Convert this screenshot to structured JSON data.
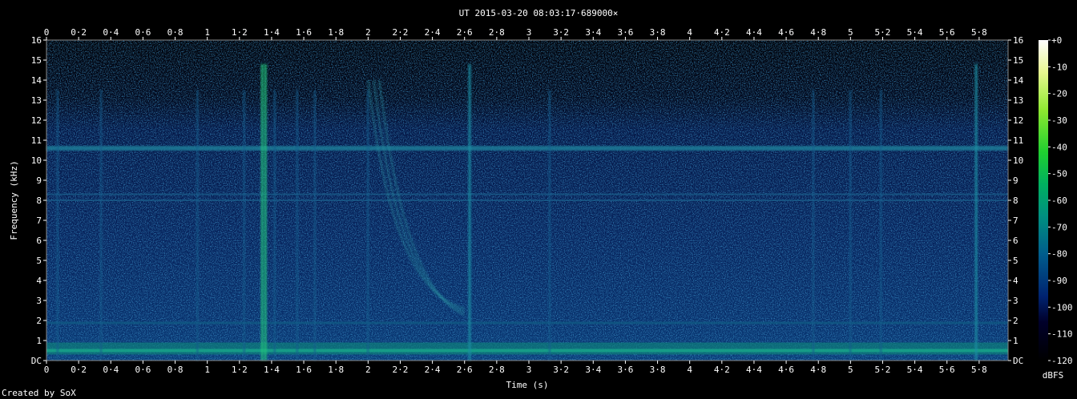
{
  "chart_data": {
    "type": "heatmap",
    "title": "UT 2015-03-20 08:03:17·689000×",
    "xlabel": "Time (s)",
    "ylabel": "Frequency (kHz)",
    "xlim": [
      0,
      5.98
    ],
    "ylim": [
      0,
      16
    ],
    "x_ticks": [
      "0",
      "0·2",
      "0·4",
      "0·6",
      "0·8",
      "1",
      "1·2",
      "1·4",
      "1·6",
      "1·8",
      "2",
      "2·2",
      "2·4",
      "2·6",
      "2·8",
      "3",
      "3·2",
      "3·4",
      "3·6",
      "3·8",
      "4",
      "4·2",
      "4·4",
      "4·6",
      "4·8",
      "5",
      "5·2",
      "5·4",
      "5·6",
      "5·8"
    ],
    "y_ticks": [
      "DC",
      "1",
      "2",
      "3",
      "4",
      "5",
      "6",
      "7",
      "8",
      "9",
      "10",
      "11",
      "12",
      "13",
      "14",
      "15",
      "16"
    ],
    "colorbar": {
      "label": "dBFS",
      "range": [
        -120,
        0
      ],
      "ticks": [
        "+0",
        "-10",
        "-20",
        "-30",
        "-40",
        "-50",
        "-60",
        "-70",
        "-80",
        "-90",
        "-100",
        "-110",
        "-120"
      ]
    },
    "features": {
      "background_level_dbfs": -100,
      "hum_band_khz": 10.6,
      "secondary_bands_khz": [
        8.3,
        8.0
      ],
      "low_band_khz": [
        0.3,
        0.9
      ],
      "vertical_events_s": [
        0.07,
        0.34,
        0.94,
        1.23,
        1.34,
        1.36,
        1.42,
        1.56,
        1.67,
        2.0,
        2.63,
        3.13,
        4.77,
        5.0,
        5.19,
        5.78
      ],
      "whistler": {
        "start_s": 2.0,
        "end_s": 2.6,
        "from_khz": 14,
        "to_khz": 2.6
      }
    },
    "credit": "Created by SoX"
  }
}
